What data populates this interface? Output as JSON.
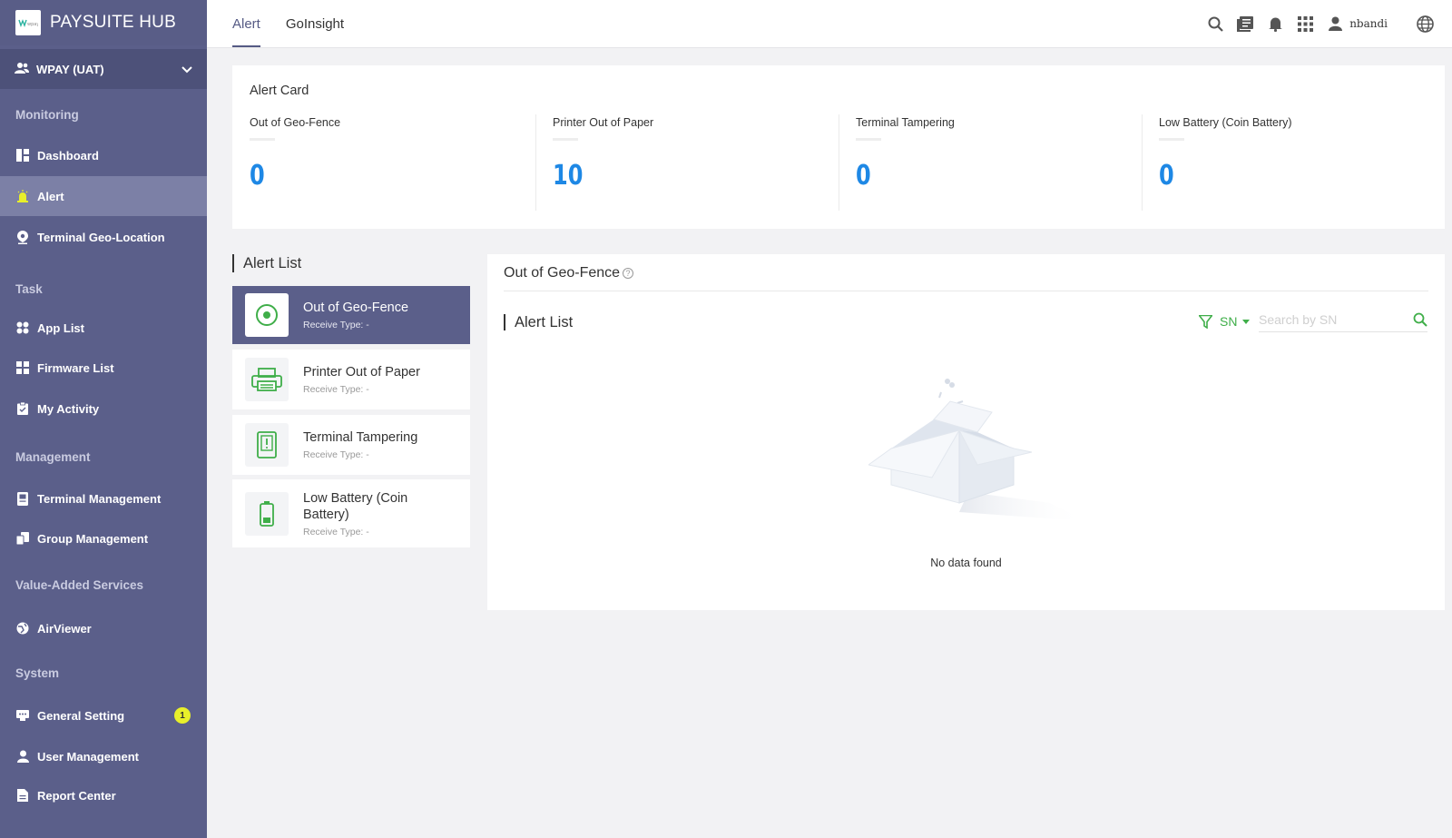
{
  "brand": {
    "title": "PAYSUITE HUB",
    "logo_text": "wpay"
  },
  "environment": {
    "label": "WPAY (UAT)"
  },
  "sidebar": {
    "sections": [
      {
        "title": "Monitoring",
        "items": [
          {
            "label": "Dashboard",
            "icon": "dashboard-icon"
          },
          {
            "label": "Alert",
            "icon": "alert-icon",
            "active": true
          },
          {
            "label": "Terminal Geo-Location",
            "icon": "location-pin-icon"
          }
        ]
      },
      {
        "title": "Task",
        "items": [
          {
            "label": "App List",
            "icon": "apps-icon"
          },
          {
            "label": "Firmware List",
            "icon": "firmware-icon"
          },
          {
            "label": "My Activity",
            "icon": "clipboard-icon"
          }
        ]
      },
      {
        "title": "Management",
        "items": [
          {
            "label": "Terminal Management",
            "icon": "terminal-icon"
          },
          {
            "label": "Group Management",
            "icon": "group-icon"
          }
        ]
      },
      {
        "title": "Value-Added Services",
        "items": [
          {
            "label": "AirViewer",
            "icon": "airviewer-icon"
          }
        ]
      },
      {
        "title": "System",
        "items": [
          {
            "label": "General Setting",
            "icon": "settings-icon",
            "badge": "1"
          },
          {
            "label": "User Management",
            "icon": "user-icon"
          },
          {
            "label": "Report Center",
            "icon": "report-icon"
          }
        ]
      }
    ]
  },
  "topbar": {
    "tabs": [
      {
        "label": "Alert",
        "active": true
      },
      {
        "label": "GoInsight"
      }
    ],
    "user": "nbandi"
  },
  "alert_card": {
    "title": "Alert Card",
    "stats": [
      {
        "label": "Out of Geo-Fence",
        "value": "0"
      },
      {
        "label": "Printer Out of Paper",
        "value": "10"
      },
      {
        "label": "Terminal Tampering",
        "value": "0"
      },
      {
        "label": "Low Battery (Coin Battery)",
        "value": "0"
      }
    ]
  },
  "alert_list": {
    "heading": "Alert List",
    "items": [
      {
        "title": "Out of Geo-Fence",
        "receive_type": "Receive Type:  -",
        "icon": "geofence-icon",
        "active": true
      },
      {
        "title": "Printer Out of Paper",
        "receive_type": "Receive Type:  -",
        "icon": "printer-icon"
      },
      {
        "title": "Terminal Tampering",
        "receive_type": "Receive Type:  -",
        "icon": "tamper-icon"
      },
      {
        "title": "Low Battery (Coin Battery)",
        "receive_type": "Receive Type:  -",
        "icon": "battery-icon"
      }
    ]
  },
  "detail": {
    "title": "Out of Geo-Fence",
    "list_heading": "Alert List",
    "filter_label": "SN",
    "search_placeholder": "Search by SN",
    "empty_text": "No data found"
  },
  "colors": {
    "sidebar": "#5b5f8a",
    "accent_blue": "#1e88e5",
    "green": "#3fae49",
    "badge": "#e8ef2a"
  }
}
